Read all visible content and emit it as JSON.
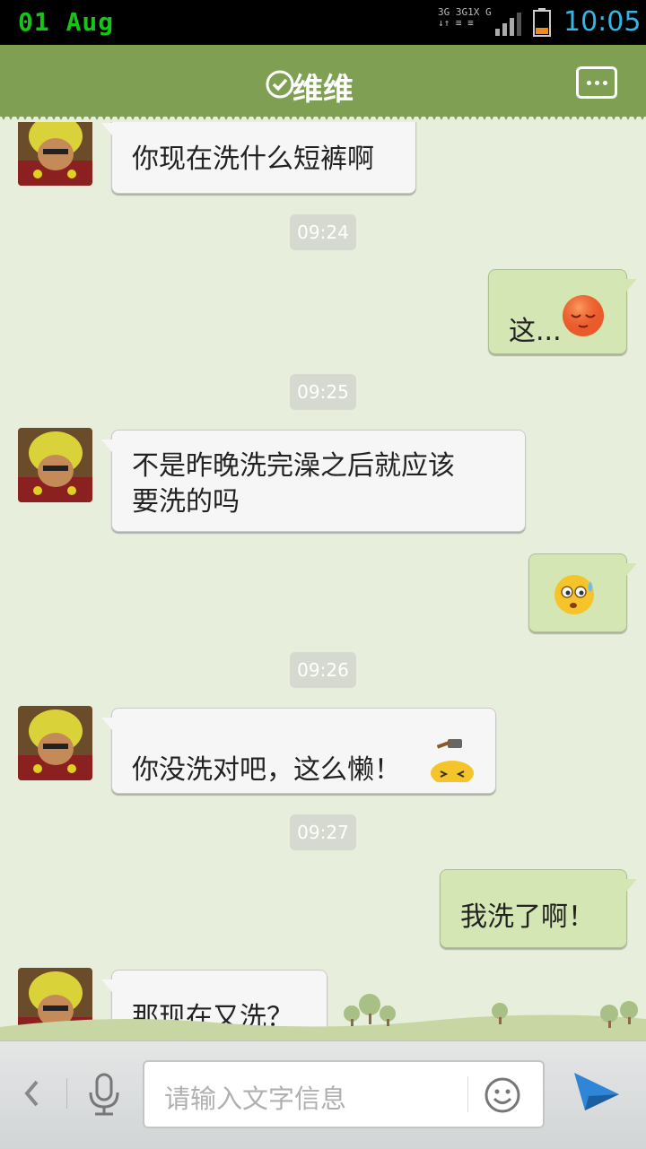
{
  "status_bar": {
    "date": "01 Aug",
    "network": [
      "3G",
      "3G",
      "1X",
      "G"
    ],
    "time": "10:05"
  },
  "header": {
    "title": "维维",
    "verified_icon": "check-circle-icon",
    "menu_icon": "more-dots-icon"
  },
  "messages": [
    {
      "type": "in",
      "text": "你现在洗什么短裤啊"
    },
    {
      "type": "time",
      "text": "09:24"
    },
    {
      "type": "out",
      "text": "这..."
    },
    {
      "type": "time",
      "text": "09:25"
    },
    {
      "type": "in",
      "line1": "不是昨晚洗完澡之后就应该",
      "line2": "要洗的吗"
    },
    {
      "type": "out_emoji",
      "emoji": "sweat-emoji-icon"
    },
    {
      "type": "time",
      "text": "09:26"
    },
    {
      "type": "in",
      "text": "你没洗对吧，这么懒！"
    },
    {
      "type": "time",
      "text": "09:27"
    },
    {
      "type": "out",
      "text": "我洗了啊！"
    },
    {
      "type": "in",
      "text": "那现在又洗？"
    }
  ],
  "input_bar": {
    "placeholder": "请输入文字信息",
    "back_icon": "chevron-left-icon",
    "voice_icon": "microphone-icon",
    "emoji_icon": "smiley-icon",
    "send_icon": "send-icon"
  },
  "colors": {
    "header_green": "#7fa052",
    "chat_bg": "#e7eedc",
    "out_bubble": "#d4e6b4",
    "send_blue": "#2f86d6"
  }
}
